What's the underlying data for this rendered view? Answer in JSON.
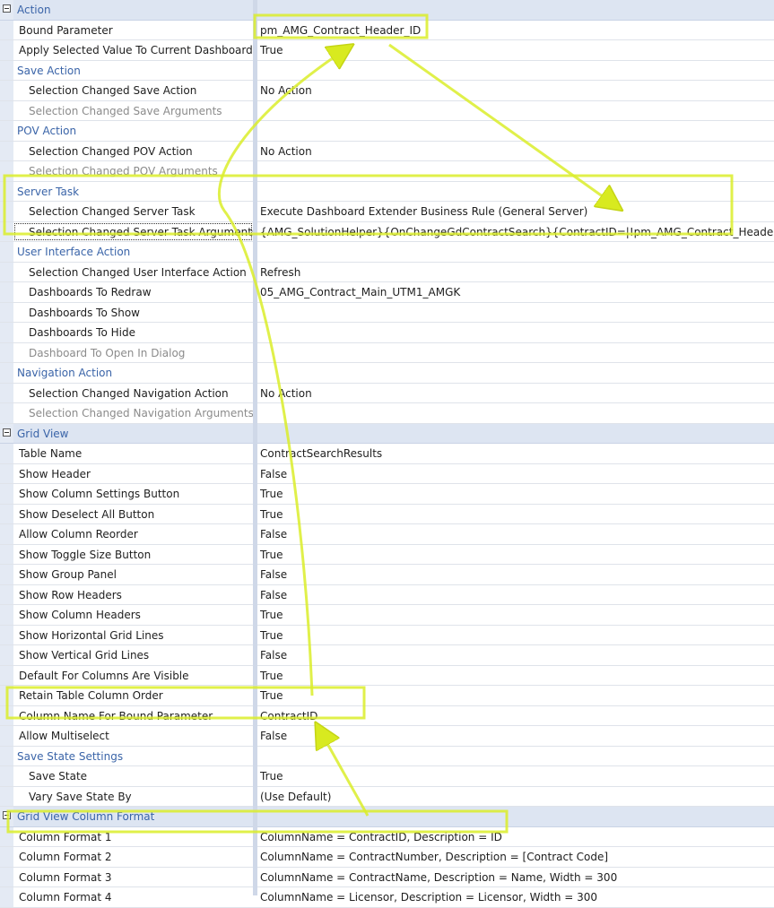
{
  "rows": [
    {
      "kind": "cat",
      "name": "Action",
      "value": ""
    },
    {
      "kind": "prop",
      "name": "Bound Parameter",
      "value": "pm_AMG_Contract_Header_ID"
    },
    {
      "kind": "prop",
      "name": "Apply Selected Value To Current Dashboard",
      "value": "True"
    },
    {
      "kind": "sub",
      "name": "Save Action",
      "value": ""
    },
    {
      "kind": "ind",
      "name": "Selection Changed Save Action",
      "value": "No Action"
    },
    {
      "kind": "ind-dis",
      "name": "Selection Changed Save Arguments",
      "value": ""
    },
    {
      "kind": "sub",
      "name": "POV Action",
      "value": ""
    },
    {
      "kind": "ind",
      "name": "Selection Changed POV Action",
      "value": "No Action"
    },
    {
      "kind": "ind-dis",
      "name": "Selection Changed POV Arguments",
      "value": ""
    },
    {
      "kind": "sub",
      "name": "Server Task",
      "value": ""
    },
    {
      "kind": "ind",
      "name": "Selection Changed Server Task",
      "value": "Execute Dashboard Extender Business Rule (General Server)"
    },
    {
      "kind": "ind-sel",
      "name": "Selection Changed Server Task Arguments",
      "value": "{AMG_SolutionHelper}{OnChangeGdContractSearch}{ContractID=|!pm_AMG_Contract_Header_ID!|}"
    },
    {
      "kind": "sub",
      "name": "User Interface Action",
      "value": ""
    },
    {
      "kind": "ind",
      "name": "Selection Changed User Interface Action",
      "value": "Refresh"
    },
    {
      "kind": "ind",
      "name": "Dashboards To Redraw",
      "value": "05_AMG_Contract_Main_UTM1_AMGK"
    },
    {
      "kind": "ind",
      "name": "Dashboards To Show",
      "value": ""
    },
    {
      "kind": "ind",
      "name": "Dashboards To Hide",
      "value": ""
    },
    {
      "kind": "ind-dis",
      "name": "Dashboard To Open In Dialog",
      "value": ""
    },
    {
      "kind": "sub",
      "name": "Navigation Action",
      "value": ""
    },
    {
      "kind": "ind",
      "name": "Selection Changed Navigation Action",
      "value": "No Action"
    },
    {
      "kind": "ind-dis",
      "name": "Selection Changed Navigation Arguments",
      "value": ""
    },
    {
      "kind": "cat",
      "name": "Grid View",
      "value": ""
    },
    {
      "kind": "prop",
      "name": "Table Name",
      "value": "ContractSearchResults"
    },
    {
      "kind": "prop",
      "name": "Show Header",
      "value": "False"
    },
    {
      "kind": "prop",
      "name": "Show Column Settings Button",
      "value": "True"
    },
    {
      "kind": "prop",
      "name": "Show Deselect All Button",
      "value": "True"
    },
    {
      "kind": "prop",
      "name": "Allow Column Reorder",
      "value": "False"
    },
    {
      "kind": "prop",
      "name": "Show Toggle Size Button",
      "value": "True"
    },
    {
      "kind": "prop",
      "name": "Show Group Panel",
      "value": "False"
    },
    {
      "kind": "prop",
      "name": "Show Row Headers",
      "value": "False"
    },
    {
      "kind": "prop",
      "name": "Show Column Headers",
      "value": "True"
    },
    {
      "kind": "prop",
      "name": "Show Horizontal Grid Lines",
      "value": "True"
    },
    {
      "kind": "prop",
      "name": "Show Vertical Grid Lines",
      "value": "False"
    },
    {
      "kind": "prop",
      "name": "Default For Columns Are Visible",
      "value": "True"
    },
    {
      "kind": "prop",
      "name": "Retain Table Column Order",
      "value": "True"
    },
    {
      "kind": "prop",
      "name": "Column Name For Bound Parameter",
      "value": "ContractID"
    },
    {
      "kind": "prop",
      "name": "Allow Multiselect",
      "value": "False"
    },
    {
      "kind": "sub",
      "name": "Save State Settings",
      "value": ""
    },
    {
      "kind": "ind",
      "name": "Save State",
      "value": "True"
    },
    {
      "kind": "ind",
      "name": "Vary Save State By",
      "value": "(Use Default)"
    },
    {
      "kind": "cat",
      "name": "Grid View Column Format",
      "value": ""
    },
    {
      "kind": "prop",
      "name": "Column Format 1",
      "value": "ColumnName = ContractID, Description = ID"
    },
    {
      "kind": "prop",
      "name": "Column Format 2",
      "value": "ColumnName = ContractNumber, Description = [Contract Code]"
    },
    {
      "kind": "prop",
      "name": "Column Format 3",
      "value": "ColumnName = ContractName, Description = Name, Width = 300"
    },
    {
      "kind": "prop",
      "name": "Column Format 4",
      "value": "ColumnName = Licensor, Description = Licensor, Width = 300"
    }
  ],
  "colors": {
    "highlight": "#d8ea1f",
    "category_bg": "#dde5f2",
    "subcategory_text": "#3a64a8"
  }
}
